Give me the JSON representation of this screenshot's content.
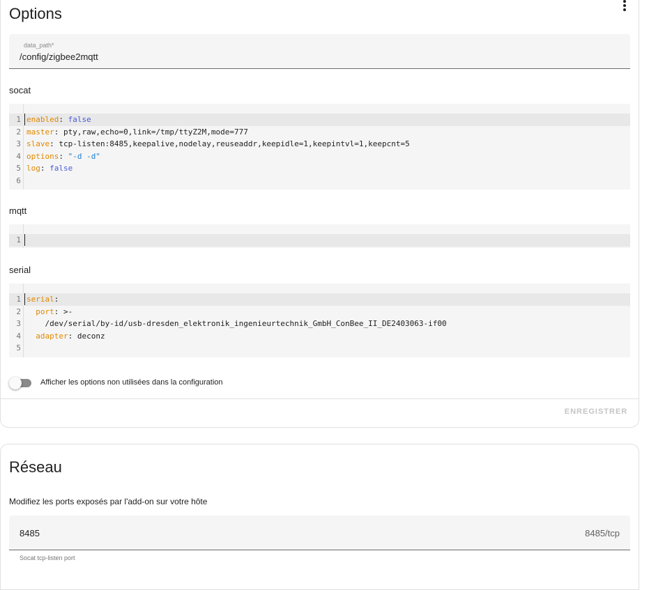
{
  "options_card": {
    "title": "Options",
    "data_path": {
      "label": "data_path*",
      "value": "/config/zigbee2mqtt"
    },
    "editors": [
      {
        "label": "socat",
        "line_numbers": [
          "1",
          "2",
          "3",
          "4",
          "5",
          "6"
        ],
        "lines": [
          {
            "key": "enabled",
            "sep": ": ",
            "val": "false",
            "val_type": "bool"
          },
          {
            "key": "master",
            "sep": ": ",
            "val": "pty,raw,echo=0,link=/tmp/ttyZ2M,mode=777",
            "val_type": "plain"
          },
          {
            "key": "slave",
            "sep": ": ",
            "val": "tcp-listen:8485,keepalive,nodelay,reuseaddr,keepidle=1,keepintvl=1,keepcnt=5",
            "val_type": "plain"
          },
          {
            "key": "options",
            "sep": ": ",
            "val": "\"-d -d\"",
            "val_type": "string"
          },
          {
            "key": "log",
            "sep": ": ",
            "val": "false",
            "val_type": "bool"
          },
          {
            "key": "",
            "sep": "",
            "val": "",
            "val_type": "plain"
          }
        ]
      },
      {
        "label": "mqtt",
        "line_numbers": [
          "1"
        ],
        "lines": [
          {
            "key": "",
            "sep": "",
            "val": "",
            "val_type": "plain"
          }
        ]
      },
      {
        "label": "serial",
        "line_numbers": [
          "1",
          "2",
          "3",
          "4",
          "5"
        ],
        "lines": [
          {
            "key": "serial",
            "sep": ":",
            "val": "",
            "val_type": "plain"
          },
          {
            "indent": "  ",
            "key": "port",
            "sep": ": ",
            "val": ">-",
            "val_type": "plain"
          },
          {
            "indent": "    ",
            "key": "",
            "sep": "",
            "val": "/dev/serial/by-id/usb-dresden_elektronik_ingenieurtechnik_GmbH_ConBee_II_DE2403063-if00",
            "val_type": "plain"
          },
          {
            "indent": "  ",
            "key": "adapter",
            "sep": ": ",
            "val": "deconz",
            "val_type": "plain"
          },
          {
            "key": "",
            "sep": "",
            "val": "",
            "val_type": "plain"
          }
        ]
      }
    ],
    "toggle": {
      "label": "Afficher les options non utilisées dans la configuration",
      "checked": false
    },
    "save_label": "ENREGISTRER"
  },
  "network_card": {
    "title": "Réseau",
    "description": "Modifiez les ports exposés par l'add-on sur votre hôte",
    "port": {
      "value": "8485",
      "suffix": "8485/tcp",
      "helper": "Socat tcp-listen port"
    }
  },
  "colors": {
    "key": "#e08800",
    "bool": "#4a5ad9",
    "string": "#1a7fd0",
    "field_bg": "#f5f5f5",
    "disabled_text": "#c4c4c4"
  }
}
